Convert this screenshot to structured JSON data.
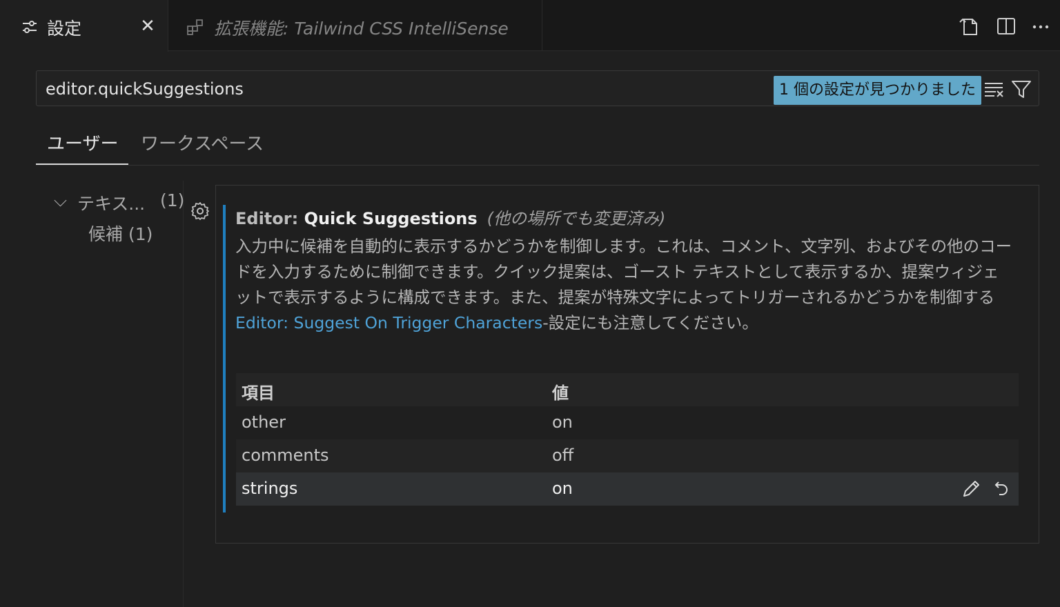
{
  "tabs": {
    "active": {
      "label": "設定",
      "icon": "settings-sliders-icon",
      "close_glyph": "✕"
    },
    "inactive": {
      "label": "拡張機能: Tailwind CSS IntelliSense",
      "icon": "extensions-icon"
    },
    "actions": [
      "open-settings-json-icon",
      "split-editor-icon",
      "more-actions-icon"
    ]
  },
  "search": {
    "value": "editor.quickSuggestions",
    "result_badge": "1 個の設定が見つかりました",
    "icons": [
      "clear-filter-icon",
      "filter-icon"
    ]
  },
  "scope_tabs": [
    {
      "label": "ユーザー",
      "selected": true
    },
    {
      "label": "ワークスペース",
      "selected": false
    }
  ],
  "toc": {
    "group": {
      "chevron": "⌵",
      "label": "テキス...",
      "count": "(1)"
    },
    "child": {
      "label": "候補 (1)"
    }
  },
  "setting": {
    "category": "Editor: ",
    "name": "Quick Suggestions",
    "modified_note": "(他の場所でも変更済み)",
    "description_prefix": "入力中に候補を自動的に表示するかどうかを制御します。これは、コメント、文字列、およびその他のコードを入力するために制御できます。クイック提案は、ゴースト テキストとして表示するか、提案ウィジェットで表示するように構成できます。また、提案が特殊文字によってトリガーされるかどうかを制御する ",
    "description_link": "Editor: Suggest On Trigger Characters",
    "description_suffix": "-設定にも注意してください。",
    "table": {
      "headers": {
        "key": "項目",
        "value": "値"
      },
      "rows": [
        {
          "key": "other",
          "value": "on"
        },
        {
          "key": "comments",
          "value": "off"
        },
        {
          "key": "strings",
          "value": "on"
        }
      ]
    }
  },
  "colors": {
    "accent_bar": "#1f7fbf",
    "badge": "#62a8c9",
    "link": "#4fa3d8"
  }
}
